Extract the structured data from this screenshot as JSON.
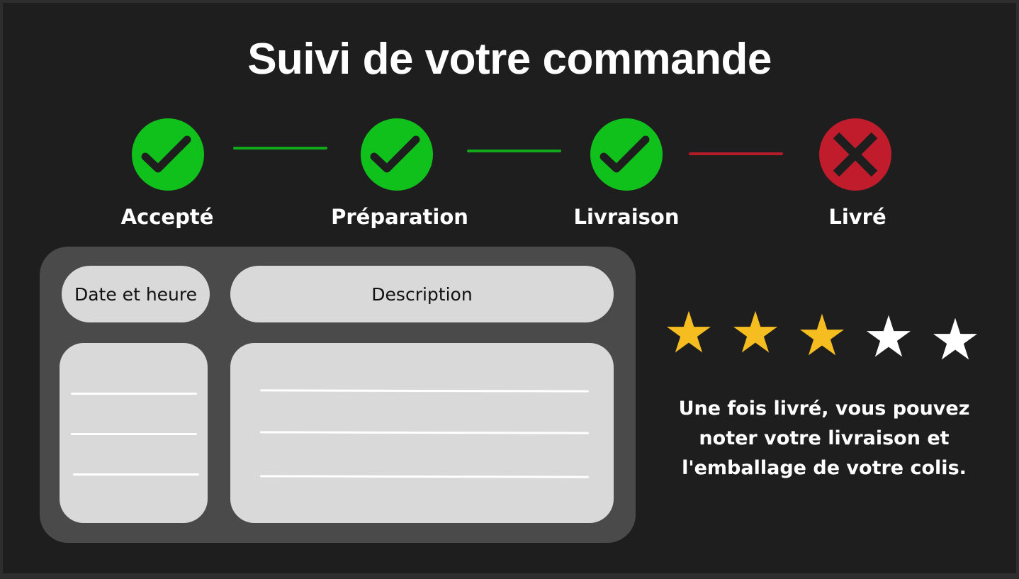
{
  "page": {
    "title": "Suivi de votre commande"
  },
  "steps": [
    {
      "label": "Accepté",
      "status": "done",
      "icon": "check-icon",
      "color": "#11c11b"
    },
    {
      "label": "Préparation",
      "status": "done",
      "icon": "check-icon",
      "color": "#11c11b"
    },
    {
      "label": "Livraison",
      "status": "done",
      "icon": "check-icon",
      "color": "#11c11b"
    },
    {
      "label": "Livré",
      "status": "not-done",
      "icon": "cross-icon",
      "color": "#c01c2c"
    }
  ],
  "connectors": [
    {
      "status": "done",
      "color": "#11a81b"
    },
    {
      "status": "done",
      "color": "#11a81b"
    },
    {
      "status": "pending",
      "color": "#b51c2a"
    }
  ],
  "history": {
    "columns": [
      "Date et heure",
      "Description"
    ]
  },
  "rating": {
    "value": 3,
    "max": 5,
    "filled_color": "#f6bd21",
    "empty_color": "#ffffff"
  },
  "note": "Une fois livré, vous pouvez noter votre livraison et l'emballage de votre colis."
}
